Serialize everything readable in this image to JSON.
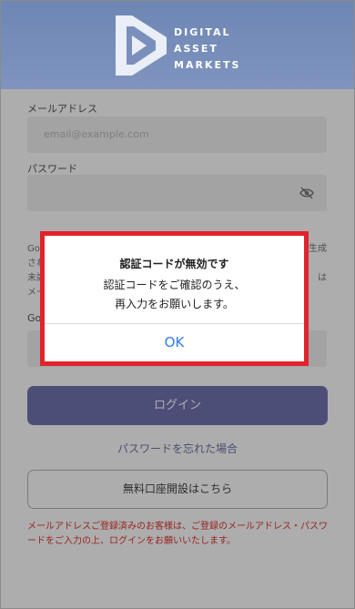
{
  "header": {
    "brand_lines": [
      "DIGITAL",
      "ASSET",
      "MARKETS"
    ]
  },
  "form": {
    "email_label": "メールアドレス",
    "email_placeholder": "email@example.com",
    "password_label": "パスワード",
    "password_toggle_icon": "eye-slash-icon",
    "partial_text_line1_left": "Go",
    "partial_text_line1_right": "生成",
    "partial_text_line2_left": "され",
    "partial_text_line3_left": "未認",
    "partial_text_line3_right": "は",
    "partial_text_line4_left": "メー",
    "partial_label_left": "Go",
    "login_button": "ログイン",
    "forgot_password": "パスワードを忘れた場合",
    "open_account_button": "無料口座開設はこちら",
    "notice": "メールアドレスご登録済みのお客様は、ご登録のメールアドレス・パスワードをご入力の上、ログインをお願いいたします。"
  },
  "dialog": {
    "title": "認証コードが無効です",
    "message_line1": "認証コードをご確認のうえ、",
    "message_line2": "再入力をお願いします。",
    "ok_label": "OK"
  },
  "colors": {
    "header": "#7388b7",
    "primary_button": "#7274b2",
    "link": "#6f74a8",
    "notice": "#e0352e",
    "dialog_highlight": "#e2232b",
    "ok": "#2f7ae8"
  }
}
